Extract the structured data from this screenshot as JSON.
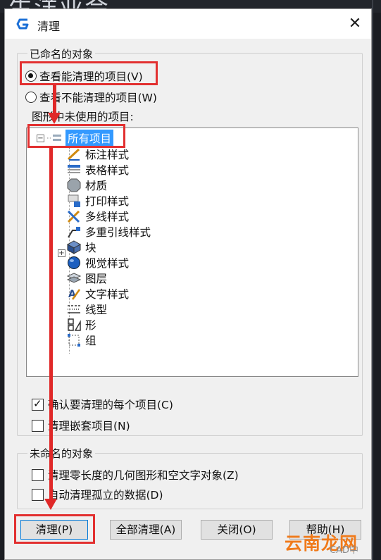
{
  "background": {
    "text": "生洋业会"
  },
  "dialog": {
    "title": "清理",
    "app_icon": "gstarcad-logo-icon",
    "close": "✕"
  },
  "named": {
    "group_label": "已命名的对象",
    "radio_view_purgeable": "查看能清理的项目(V)",
    "radio_view_nonpurgeable": "查看不能清理的项目(W)",
    "selected": "view_purgeable",
    "tree_label": "图形中未使用的项目:",
    "tree_root": "所有项目",
    "tree_items": [
      {
        "label": "标注样式",
        "icon": "dimension-style-icon"
      },
      {
        "label": "表格样式",
        "icon": "table-style-icon"
      },
      {
        "label": "材质",
        "icon": "material-icon"
      },
      {
        "label": "打印样式",
        "icon": "plot-style-icon"
      },
      {
        "label": "多线样式",
        "icon": "multiline-style-icon"
      },
      {
        "label": "多重引线样式",
        "icon": "mleader-style-icon"
      },
      {
        "label": "块",
        "icon": "block-icon"
      },
      {
        "label": "视觉样式",
        "icon": "visual-style-icon"
      },
      {
        "label": "图层",
        "icon": "layer-icon"
      },
      {
        "label": "文字样式",
        "icon": "text-style-icon"
      },
      {
        "label": "线型",
        "icon": "linetype-icon"
      },
      {
        "label": "形",
        "icon": "shape-icon"
      },
      {
        "label": "组",
        "icon": "group-icon"
      }
    ],
    "check_confirm": "确认要清理的每个项目(C)",
    "check_confirm_on": true,
    "check_nested": "清理嵌套项目(N)",
    "check_nested_on": false
  },
  "unnamed": {
    "group_label": "未命名的对象",
    "check_zero_length": "清理零长度的几何图形和空文字对象(Z)",
    "check_orphan": "自动清理孤立的数据(D)"
  },
  "buttons": {
    "purge": "清理(P)",
    "purge_all": "全部清理(A)",
    "close": "关闭(O)",
    "help": "帮助(H)"
  },
  "watermark": {
    "logo": "云南龙网",
    "text": "CAD中"
  },
  "colors": {
    "highlight": "#e23030",
    "selection": "#3399ff"
  }
}
